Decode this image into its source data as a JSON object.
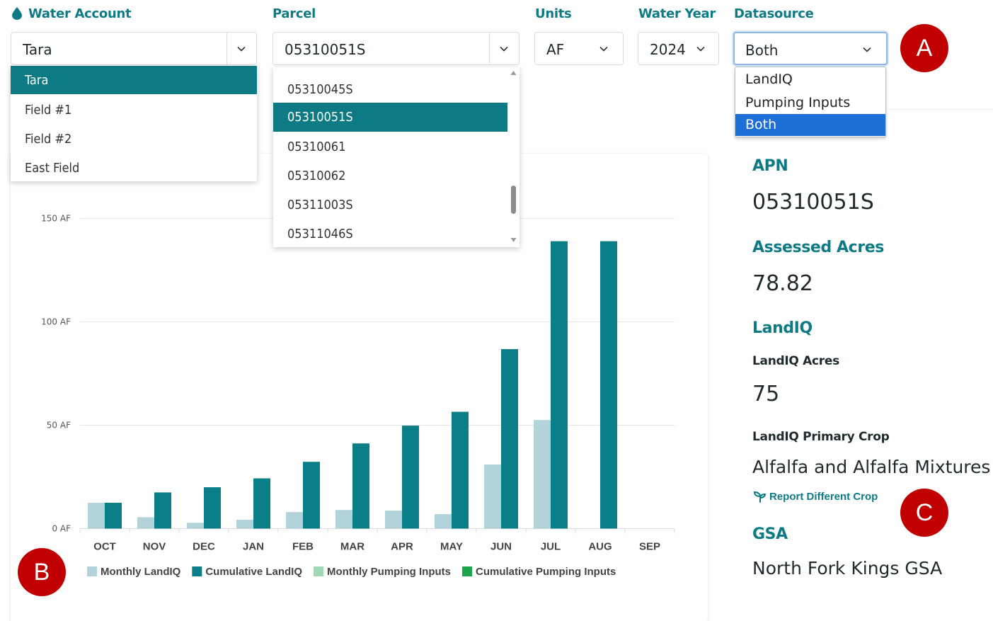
{
  "filters": {
    "water_account": {
      "label": "Water Account",
      "value": "Tara",
      "options": [
        "Tara",
        "Field #1",
        "Field #2",
        "East Field"
      ],
      "selected_index": 0
    },
    "parcel": {
      "label": "Parcel",
      "value": "05310051S",
      "options": [
        "05310045S",
        "05310051S",
        "05310061",
        "05310062",
        "05311003S",
        "05311046S"
      ],
      "selected_index": 1
    },
    "units": {
      "label": "Units",
      "value": "AF"
    },
    "water_year": {
      "label": "Water Year",
      "value": "2024"
    },
    "datasource": {
      "label": "Datasource",
      "value": "Both",
      "options": [
        "LandIQ",
        "Pumping Inputs",
        "Both"
      ],
      "selected_index": 2
    }
  },
  "callouts": {
    "a": "A",
    "b": "B",
    "c": "C"
  },
  "info": {
    "apn_label": "APN",
    "apn_value": "05310051S",
    "acres_label": "Assessed Acres",
    "acres_value": "78.82",
    "landiq_heading": "LandIQ",
    "landiq_acres_label": "LandIQ Acres",
    "landiq_acres_value": "75",
    "primary_crop_label": "LandIQ Primary Crop",
    "primary_crop_value": "Alfalfa and Alfalfa Mixtures",
    "report_link": "Report Different Crop",
    "gsa_label": "GSA",
    "gsa_value": "North Fork Kings GSA"
  },
  "colors": {
    "accent": "#0e7b84",
    "monthly_landiq": "#b3d3da",
    "cumulative_landiq": "#0b7f87",
    "monthly_pumping": "#9fd8b5",
    "cumulative_pumping": "#1aa64a",
    "callout": "#c00000",
    "highlight_blue": "#1f6fd8"
  },
  "chart_data": {
    "type": "bar",
    "categories": [
      "OCT",
      "NOV",
      "DEC",
      "JAN",
      "FEB",
      "MAR",
      "APR",
      "MAY",
      "JUN",
      "JUL",
      "AUG",
      "SEP"
    ],
    "series": [
      {
        "name": "Monthly LandIQ",
        "values": [
          12.5,
          5.5,
          2.8,
          4.3,
          8.0,
          9.0,
          8.7,
          7.0,
          31.0,
          52.5,
          0,
          0
        ]
      },
      {
        "name": "Cumulative LandIQ",
        "values": [
          12.5,
          17.5,
          20.0,
          24.3,
          32.3,
          41.2,
          49.8,
          56.5,
          86.8,
          139.0,
          139.0,
          0
        ]
      },
      {
        "name": "Monthly Pumping Inputs",
        "values": [
          0,
          0,
          0,
          0,
          0,
          0,
          0,
          0,
          0,
          0,
          0,
          0
        ]
      },
      {
        "name": "Cumulative Pumping Inputs",
        "values": [
          0,
          0,
          0,
          0,
          0,
          0,
          0,
          0,
          0,
          0,
          0,
          0
        ]
      }
    ],
    "yticks": [
      "0 AF",
      "50 AF",
      "100 AF",
      "150 AF"
    ],
    "ytick_values": [
      0,
      50,
      100,
      150
    ],
    "ylim": [
      0,
      150
    ],
    "grid": true,
    "legend": "bottom"
  }
}
